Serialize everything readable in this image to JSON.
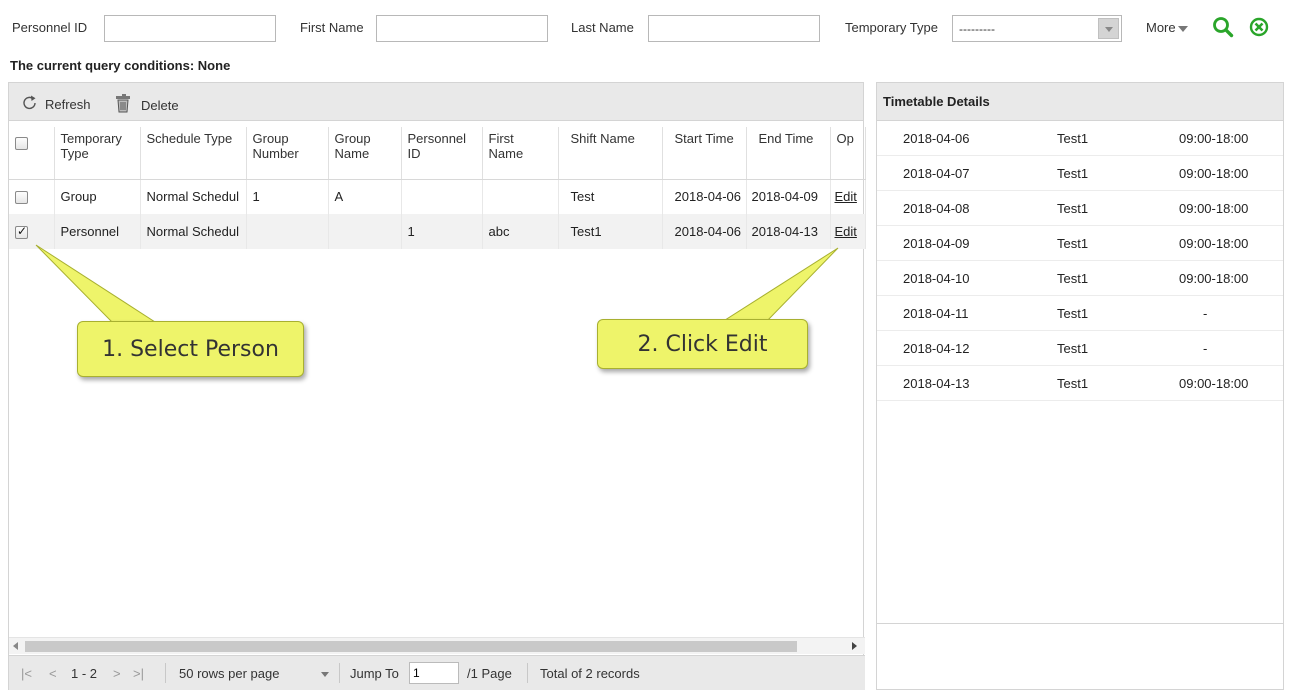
{
  "search": {
    "personnel_id_label": "Personnel ID",
    "first_name_label": "First Name",
    "last_name_label": "Last Name",
    "temporary_type_label": "Temporary Type",
    "temporary_type_value": "---------",
    "more_label": "More"
  },
  "query_conditions": "The current query conditions: None",
  "toolbar": {
    "refresh": "Refresh",
    "delete": "Delete"
  },
  "table": {
    "headers": [
      "Temporary Type",
      "Schedule Type",
      "Group Number",
      "Group Name",
      "Personnel ID",
      "First Name",
      "Shift Name",
      "Start Time",
      "End Time",
      "Op"
    ],
    "rows": [
      {
        "checked": false,
        "temporary_type": "Group",
        "schedule_type": "Normal Schedul",
        "group_number": "1",
        "group_name": "A",
        "personnel_id": "",
        "first_name": "",
        "shift_name": "Test",
        "start_time": "2018-04-06",
        "end_time": "2018-04-09",
        "op": "Edit"
      },
      {
        "checked": true,
        "temporary_type": "Personnel",
        "schedule_type": "Normal Schedul",
        "group_number": "",
        "group_name": "",
        "personnel_id": "1",
        "first_name": "abc",
        "shift_name": "Test1",
        "start_time": "2018-04-06",
        "end_time": "2018-04-13",
        "op": "Edit"
      }
    ]
  },
  "pager": {
    "range": "1 - 2",
    "rows_per_page": "50 rows per page",
    "jump_to_label": "Jump To",
    "jump_to_value": "1",
    "page_total": "/1 Page",
    "total_records": "Total of 2 records"
  },
  "timetable": {
    "title": "Timetable Details",
    "rows": [
      {
        "date": "2018-04-06",
        "shift": "Test1",
        "time": "09:00-18:00"
      },
      {
        "date": "2018-04-07",
        "shift": "Test1",
        "time": "09:00-18:00"
      },
      {
        "date": "2018-04-08",
        "shift": "Test1",
        "time": "09:00-18:00"
      },
      {
        "date": "2018-04-09",
        "shift": "Test1",
        "time": "09:00-18:00"
      },
      {
        "date": "2018-04-10",
        "shift": "Test1",
        "time": "09:00-18:00"
      },
      {
        "date": "2018-04-11",
        "shift": "Test1",
        "time": "-"
      },
      {
        "date": "2018-04-12",
        "shift": "Test1",
        "time": "-"
      },
      {
        "date": "2018-04-13",
        "shift": "Test1",
        "time": "09:00-18:00"
      }
    ]
  },
  "callouts": {
    "select_person": "1. Select Person",
    "click_edit": "2. Click Edit"
  },
  "colors": {
    "accent_green": "#2aa52a",
    "callout_yellow": "#eef46a",
    "toolbar_gray": "#e9e9e9"
  },
  "icons": {
    "search": "search-icon",
    "clear": "clear-icon",
    "refresh": "refresh-icon",
    "delete": "delete-icon"
  }
}
